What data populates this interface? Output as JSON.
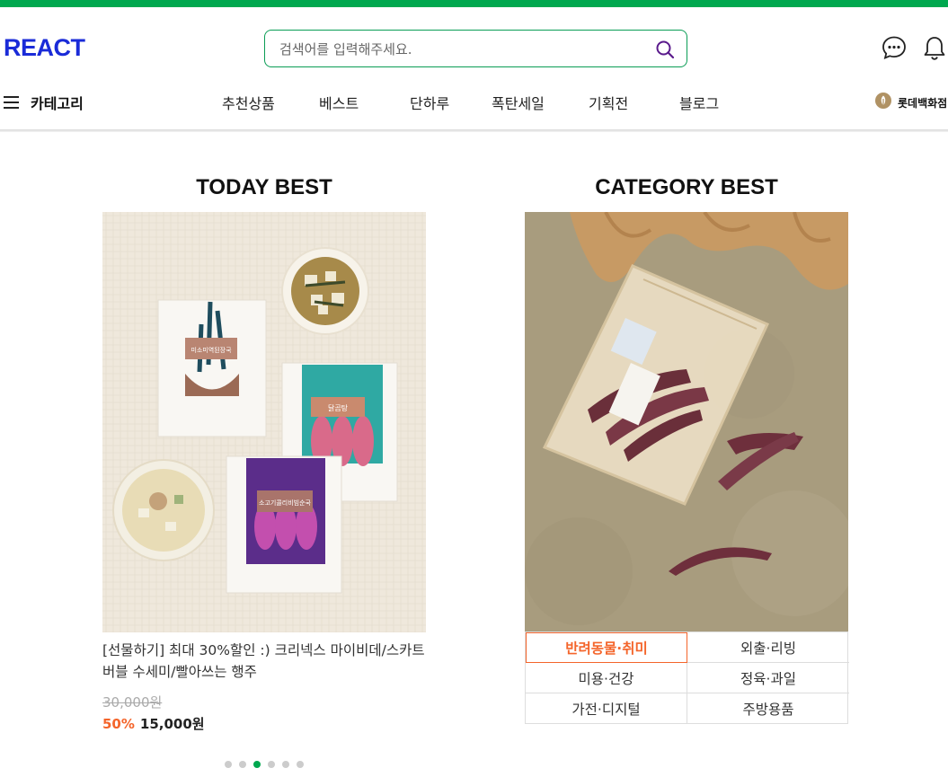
{
  "header": {
    "logo": "REACT",
    "search": {
      "placeholder": "검색어를 입력해주세요."
    },
    "icons": [
      "search-icon",
      "chat-icon",
      "bell-icon"
    ]
  },
  "nav": {
    "menu_label": "카테고리",
    "items": [
      "추천상품",
      "베스트",
      "단하루",
      "폭탄세일",
      "기획전",
      "블로그"
    ],
    "partner": "롯데백화점"
  },
  "today_best": {
    "title": "TODAY BEST",
    "product": {
      "name": "[선물하기] 최대 30%할인 :) 크리넥스 마이비데/스카트 버블 수세미/빨아쓰는 행주",
      "original_price": "30,000원",
      "discount": "50%",
      "sale_price": "15,000원"
    },
    "image_labels": [
      "미소미역된장국",
      "닭곰탕",
      "소고기콜리비빔순국"
    ],
    "carousel": {
      "count": 6,
      "active": 2
    }
  },
  "category_best": {
    "title": "CATEGORY BEST",
    "categories": [
      "반려동물·취미",
      "외출·리빙",
      "미용·건강",
      "정육·과일",
      "가전·디지털",
      "주방용품"
    ],
    "active_index": 0
  },
  "colors": {
    "brand_green": "#00a84f",
    "logo_blue": "#1a2bd8",
    "accent_orange": "#f4652b"
  }
}
